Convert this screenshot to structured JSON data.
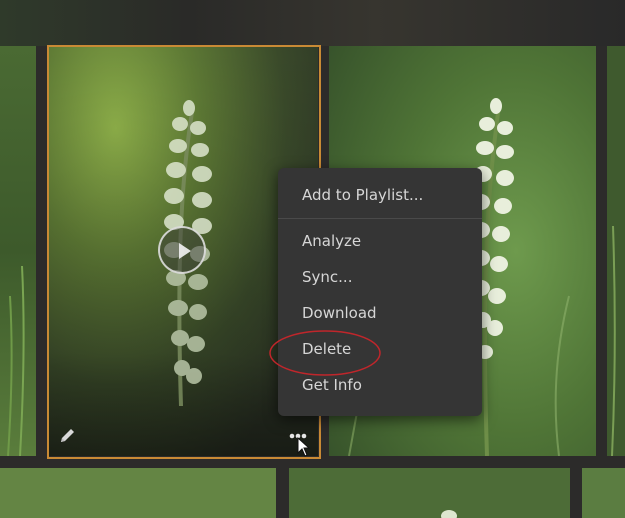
{
  "context_menu": {
    "items": [
      {
        "label": "Add to Playlist..."
      },
      {
        "label": "Analyze"
      },
      {
        "label": "Sync..."
      },
      {
        "label": "Download"
      },
      {
        "label": "Delete"
      },
      {
        "label": "Get Info"
      }
    ],
    "highlighted_item": "Delete"
  },
  "colors": {
    "selection_border": "#c98a35",
    "menu_background": "#353535",
    "menu_text": "#d6d6d6",
    "annotation_circle": "#c0262b"
  },
  "icons": {
    "play": "play-icon",
    "edit": "pencil-icon",
    "more": "more-options-icon",
    "cursor": "mouse-pointer-icon"
  }
}
